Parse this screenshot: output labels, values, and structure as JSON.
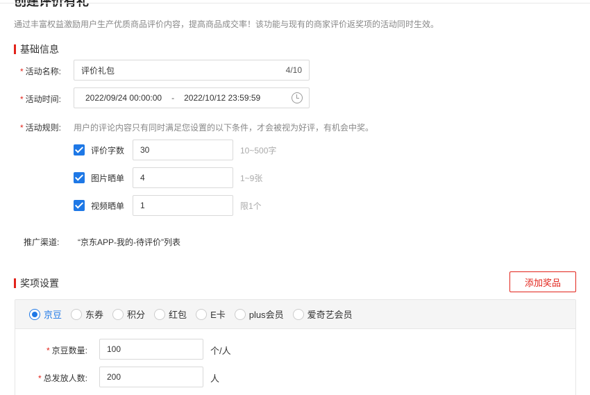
{
  "header": {
    "title": "创建评价有礼",
    "description": "通过丰富权益激励用户生产优质商品评价内容，提高商品成交率！该功能与现有的商家评价返奖项的活动同时生效。"
  },
  "basic": {
    "section_title": "基础信息",
    "name_label": "活动名称:",
    "name_value": "评价礼包",
    "name_count": "4/10",
    "time_label": "活动时间:",
    "time_start": "2022/09/24 00:00:00",
    "time_sep": "-",
    "time_end": "2022/10/12 23:59:59",
    "rules_label": "活动规则:",
    "rules_hint": "用户的评论内容只有同时满足您设置的以下条件，才会被视为好评，有机会中奖。",
    "rules": [
      {
        "label": "评价字数",
        "value": "30",
        "limit": "10~500字",
        "checked": true
      },
      {
        "label": "图片晒单",
        "value": "4",
        "limit": "1~9张",
        "checked": true
      },
      {
        "label": "视频晒单",
        "value": "1",
        "limit": "限1个",
        "checked": true
      }
    ],
    "channel_label": "推广渠道:",
    "channel_value": "“京东APP-我的-待评价”列表"
  },
  "prize": {
    "section_title": "奖项设置",
    "add_button": "添加奖品",
    "types": [
      "京豆",
      "东券",
      "积分",
      "红包",
      "E卡",
      "plus会员",
      "爱奇艺会员"
    ],
    "selected_type": "京豆",
    "amount_label": "京豆数量:",
    "amount_value": "100",
    "amount_unit": "个/人",
    "total_label": "总发放人数:",
    "total_value": "200",
    "total_unit": "人"
  },
  "colors": {
    "accent": "#1e78e6",
    "brand_red": "#e2231a"
  }
}
